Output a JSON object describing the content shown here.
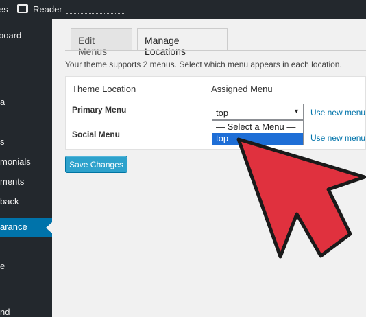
{
  "adminbar": {
    "left_text": "es",
    "reader_label": "Reader",
    "reader_icon": "reader-icon"
  },
  "sidebar": {
    "items": [
      {
        "label": "board"
      },
      {
        "label": "a"
      },
      {
        "label": "s"
      },
      {
        "label": "monials"
      },
      {
        "label": "ments"
      },
      {
        "label": "back"
      },
      {
        "label": "arance",
        "active": true
      },
      {
        "label": "e"
      },
      {
        "label": "nd"
      }
    ]
  },
  "tabs": [
    {
      "label": "Edit Menus",
      "active": false
    },
    {
      "label": "Manage Locations",
      "active": true
    }
  ],
  "intro": "Your theme supports 2 menus. Select which menu appears in each location.",
  "table": {
    "headers": [
      "Theme Location",
      "Assigned Menu"
    ],
    "rows": [
      {
        "location": "Primary Menu",
        "link": "Use new menu"
      },
      {
        "location": "Social Menu",
        "link": "Use new menu"
      }
    ]
  },
  "select": {
    "value": "top",
    "options": [
      "— Select a Menu —",
      "top"
    ],
    "highlighted": "top"
  },
  "save_button": "Save Changes",
  "colors": {
    "accent": "#0073aa",
    "button": "#2ea2cc",
    "arrow": "#e0313e",
    "admin_dark": "#23282d"
  }
}
